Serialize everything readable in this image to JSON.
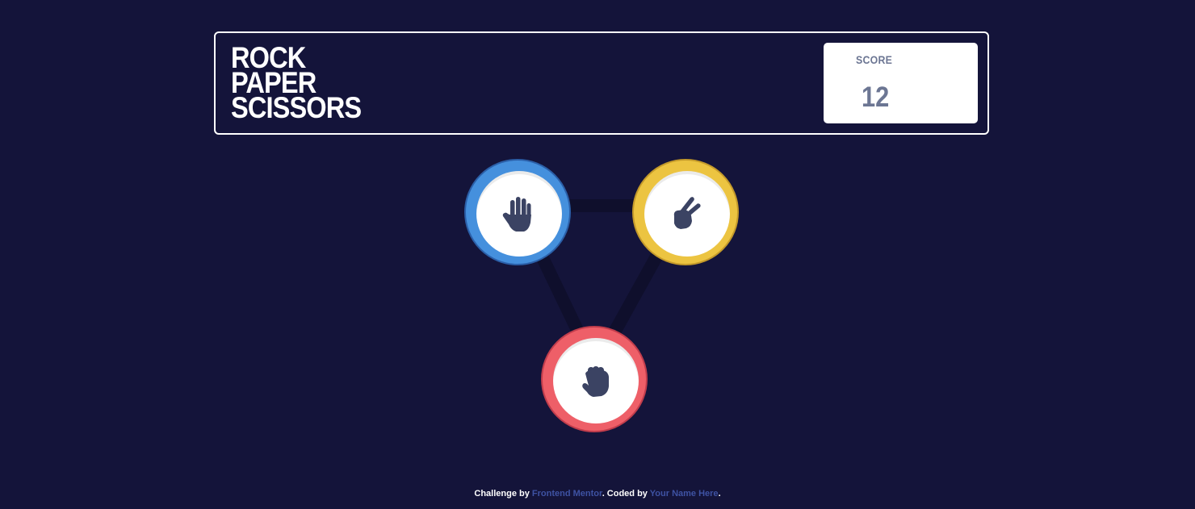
{
  "header": {
    "title_lines": [
      "ROCK",
      "PAPER",
      "SCISSORS"
    ],
    "score_label": "SCORE",
    "score_value": "12"
  },
  "choices": [
    {
      "id": "paper",
      "icon": "paper-hand-icon",
      "ring_color": "#4590dd",
      "edge_color": "#2b5fa8"
    },
    {
      "id": "scissors",
      "icon": "scissors-hand-icon",
      "ring_color": "#ecc441",
      "edge_color": "#c49a2a"
    },
    {
      "id": "rock",
      "icon": "rock-fist-icon",
      "ring_color": "#ee5f68",
      "edge_color": "#c13d4c"
    }
  ],
  "footer": {
    "prefix": "Challenge by ",
    "challenge_link": "Frontend Mentor",
    "middle": ". Coded by ",
    "author_link": "Your Name Here",
    "suffix": "."
  },
  "colors": {
    "background": "#14143a",
    "icon": "#3b4363",
    "link": "#3e52a3",
    "triangle": "#0f0f2c"
  }
}
